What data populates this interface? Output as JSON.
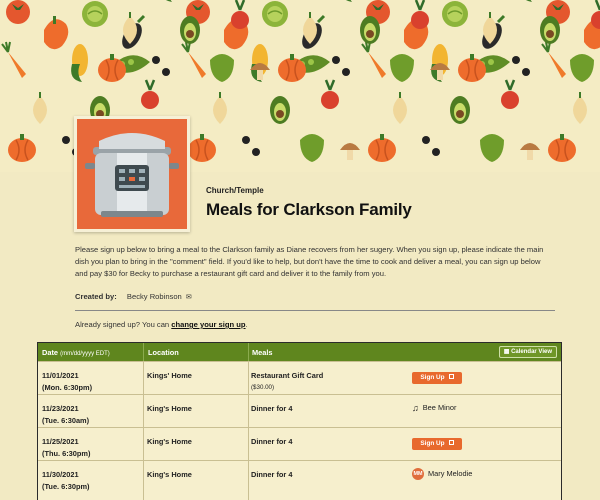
{
  "page": {
    "category": "Church/Temple",
    "title": "Meals for Clarkson Family",
    "description": "Please sign up below to bring a meal to the Clarkson family as Diane recovers from her sugery. When you sign up, please indicate the main dish you plan to bring in the \"comment\" field. If you'd like to help, but don't have the time to cook and deliver a meal, you can sign up below and pay $30 for Becky to purchase a restaurant gift card and deliver it to the family from you.",
    "created_by_label": "Created by:",
    "created_by_name": "Becky Robinson",
    "mail_icon": "envelope-icon",
    "already_signed_text": "Already signed up? You can",
    "change_link": "change your sign up",
    "period": "."
  },
  "colors": {
    "header_green": "#5f861e",
    "signup_orange": "#e8692d",
    "thumb_orange": "#e8693a"
  },
  "table": {
    "headers": {
      "date": "Date",
      "date_hint": "(mm/dd/yyyy EDT)",
      "location": "Location",
      "meals": "Meals",
      "calendar_view": "Calendar View",
      "calendar_icon": "calendar-icon"
    },
    "rows": [
      {
        "date": "11/01/2021",
        "time": "(Mon. 6:30pm)",
        "location": "Kings' Home",
        "meal": "Restaurant Gift Card",
        "meal_note": "($30.00)",
        "action": "Sign Up",
        "volunteer": ""
      },
      {
        "date": "11/23/2021",
        "time": "(Tue. 6:30am)",
        "location": "King's Home",
        "meal": "Dinner for 4",
        "meal_note": "",
        "action": "",
        "volunteer": "Bee Minor",
        "volunteer_icon": "music-note-icon"
      },
      {
        "date": "11/25/2021",
        "time": "(Thu. 6:30pm)",
        "location": "King's Home",
        "meal": "Dinner for 4",
        "meal_note": "",
        "action": "Sign Up",
        "volunteer": ""
      },
      {
        "date": "11/30/2021",
        "time": "(Tue. 6:30pm)",
        "location": "King's Home",
        "meal": "Dinner for 4",
        "meal_note": "",
        "action": "",
        "volunteer": "Mary Melodie",
        "volunteer_initials": "MM"
      }
    ]
  }
}
